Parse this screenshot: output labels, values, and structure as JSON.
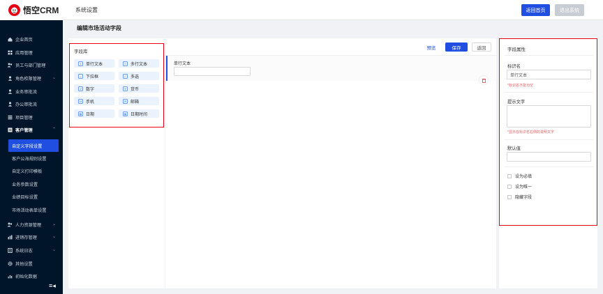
{
  "brand": {
    "name": "悟空CRM",
    "logo_color": "#e60012"
  },
  "header": {
    "title": "系统设置",
    "home_button": "返回首页",
    "logout_button": "退出系统"
  },
  "sidebar": {
    "items": [
      {
        "label": "企业首页",
        "icon": "home-icon"
      },
      {
        "label": "应用管理",
        "icon": "apps-icon"
      },
      {
        "label": "员工与部门管理",
        "icon": "users-icon"
      },
      {
        "label": "角色权限管理",
        "icon": "role-icon"
      },
      {
        "label": "业务审批流",
        "icon": "person-icon"
      },
      {
        "label": "办公审批流",
        "icon": "person-icon"
      },
      {
        "label": "项目管理",
        "icon": "project-icon"
      },
      {
        "label": "客户管理",
        "icon": "customer-icon"
      }
    ],
    "sub_items": [
      {
        "label": "自定义字段设置"
      },
      {
        "label": "客户公海规则设置"
      },
      {
        "label": "自定义打印模板"
      },
      {
        "label": "业务参数设置"
      },
      {
        "label": "业绩目标设置"
      },
      {
        "label": "市场活动表单设置"
      }
    ],
    "bottom_items": [
      {
        "label": "人力资源管理",
        "icon": "hr-icon"
      },
      {
        "label": "进销存管理",
        "icon": "stock-icon"
      },
      {
        "label": "系统日志",
        "icon": "log-icon"
      },
      {
        "label": "其他设置",
        "icon": "gear-icon"
      },
      {
        "label": "初始化数据",
        "icon": "chart-icon"
      }
    ]
  },
  "page": {
    "title": "编辑市场活动字段"
  },
  "library": {
    "title": "字段库",
    "fields": [
      {
        "label": "单行文本"
      },
      {
        "label": "多行文本"
      },
      {
        "label": "下拉框"
      },
      {
        "label": "多选"
      },
      {
        "label": "数字"
      },
      {
        "label": "货币"
      },
      {
        "label": "手机"
      },
      {
        "label": "邮箱"
      },
      {
        "label": "日期"
      },
      {
        "label": "日期时间"
      }
    ]
  },
  "canvas": {
    "preview": "预览",
    "save": "保存",
    "back": "返回",
    "field_label": "单行文本"
  },
  "props": {
    "title": "字段属性",
    "name_label": "标识名",
    "name_value": "单行文本",
    "name_hint": "*标识名不能为空",
    "tip_label": "提示文字",
    "tip_hint": "*显示在标识名右侧的说明文字",
    "default_label": "默认值",
    "checks": [
      "设为必填",
      "设为唯一",
      "隐藏字段"
    ]
  },
  "colors": {
    "primary": "#1f4ee0",
    "highlight": "#e60012",
    "sidebar": "#001529"
  }
}
